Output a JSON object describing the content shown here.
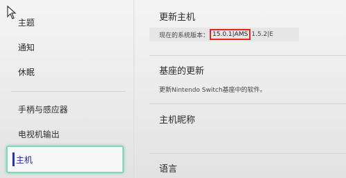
{
  "sidebar": {
    "items": [
      {
        "label": "主题"
      },
      {
        "label": "通知"
      },
      {
        "label": "休眠"
      },
      {
        "label": "手柄与感应器"
      },
      {
        "label": "电视机输出"
      },
      {
        "label": "主机"
      }
    ],
    "selected_index": 5
  },
  "content": {
    "update": {
      "title": "更新主机",
      "version_label": "现在的系统版本：",
      "version_highlight": "15.0.1|AMS",
      "version_tail": "1.5.2|E"
    },
    "dock_update": {
      "title": "基座的更新",
      "description": "更新Nintendo Switch基座中的软件。"
    },
    "nickname": {
      "title": "主机昵称"
    },
    "language": {
      "title": "语言"
    }
  },
  "colors": {
    "selection_outline": "#7fd6b8",
    "selection_accent": "#2636a8",
    "highlight_box": "#e0241f"
  },
  "icons": {
    "cursor": "mouse-pointer-icon"
  }
}
